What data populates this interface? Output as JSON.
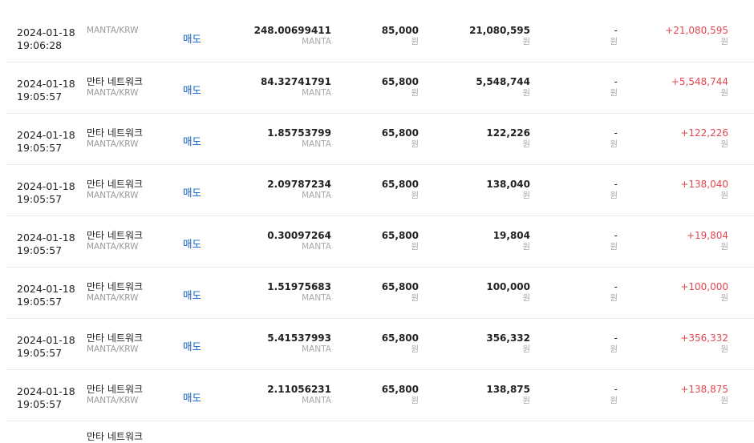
{
  "rows": [
    {
      "date": "2024-01-18",
      "time": "19:06:28",
      "asset": "",
      "pair": "MANTA/KRW",
      "type": "매도",
      "qty": "248.00699411",
      "qty_unit": "MANTA",
      "price": "85,000",
      "price_unit": "원",
      "amount": "21,080,595",
      "amount_unit": "원",
      "fee": "-",
      "fee_unit": "원",
      "total": "+21,080,595",
      "total_unit": "원"
    },
    {
      "date": "2024-01-18",
      "time": "19:05:57",
      "asset": "만타 네트워크",
      "pair": "MANTA/KRW",
      "type": "매도",
      "qty": "84.32741791",
      "qty_unit": "MANTA",
      "price": "65,800",
      "price_unit": "원",
      "amount": "5,548,744",
      "amount_unit": "원",
      "fee": "-",
      "fee_unit": "원",
      "total": "+5,548,744",
      "total_unit": "원"
    },
    {
      "date": "2024-01-18",
      "time": "19:05:57",
      "asset": "만타 네트워크",
      "pair": "MANTA/KRW",
      "type": "매도",
      "qty": "1.85753799",
      "qty_unit": "MANTA",
      "price": "65,800",
      "price_unit": "원",
      "amount": "122,226",
      "amount_unit": "원",
      "fee": "-",
      "fee_unit": "원",
      "total": "+122,226",
      "total_unit": "원"
    },
    {
      "date": "2024-01-18",
      "time": "19:05:57",
      "asset": "만타 네트워크",
      "pair": "MANTA/KRW",
      "type": "매도",
      "qty": "2.09787234",
      "qty_unit": "MANTA",
      "price": "65,800",
      "price_unit": "원",
      "amount": "138,040",
      "amount_unit": "원",
      "fee": "-",
      "fee_unit": "원",
      "total": "+138,040",
      "total_unit": "원"
    },
    {
      "date": "2024-01-18",
      "time": "19:05:57",
      "asset": "만타 네트워크",
      "pair": "MANTA/KRW",
      "type": "매도",
      "qty": "0.30097264",
      "qty_unit": "MANTA",
      "price": "65,800",
      "price_unit": "원",
      "amount": "19,804",
      "amount_unit": "원",
      "fee": "-",
      "fee_unit": "원",
      "total": "+19,804",
      "total_unit": "원"
    },
    {
      "date": "2024-01-18",
      "time": "19:05:57",
      "asset": "만타 네트워크",
      "pair": "MANTA/KRW",
      "type": "매도",
      "qty": "1.51975683",
      "qty_unit": "MANTA",
      "price": "65,800",
      "price_unit": "원",
      "amount": "100,000",
      "amount_unit": "원",
      "fee": "-",
      "fee_unit": "원",
      "total": "+100,000",
      "total_unit": "원"
    },
    {
      "date": "2024-01-18",
      "time": "19:05:57",
      "asset": "만타 네트워크",
      "pair": "MANTA/KRW",
      "type": "매도",
      "qty": "5.41537993",
      "qty_unit": "MANTA",
      "price": "65,800",
      "price_unit": "원",
      "amount": "356,332",
      "amount_unit": "원",
      "fee": "-",
      "fee_unit": "원",
      "total": "+356,332",
      "total_unit": "원"
    },
    {
      "date": "2024-01-18",
      "time": "19:05:57",
      "asset": "만타 네트워크",
      "pair": "MANTA/KRW",
      "type": "매도",
      "qty": "2.11056231",
      "qty_unit": "MANTA",
      "price": "65,800",
      "price_unit": "원",
      "amount": "138,875",
      "amount_unit": "원",
      "fee": "-",
      "fee_unit": "원",
      "total": "+138,875",
      "total_unit": "원"
    }
  ],
  "partial_row": {
    "asset": "만타 네트워크"
  }
}
